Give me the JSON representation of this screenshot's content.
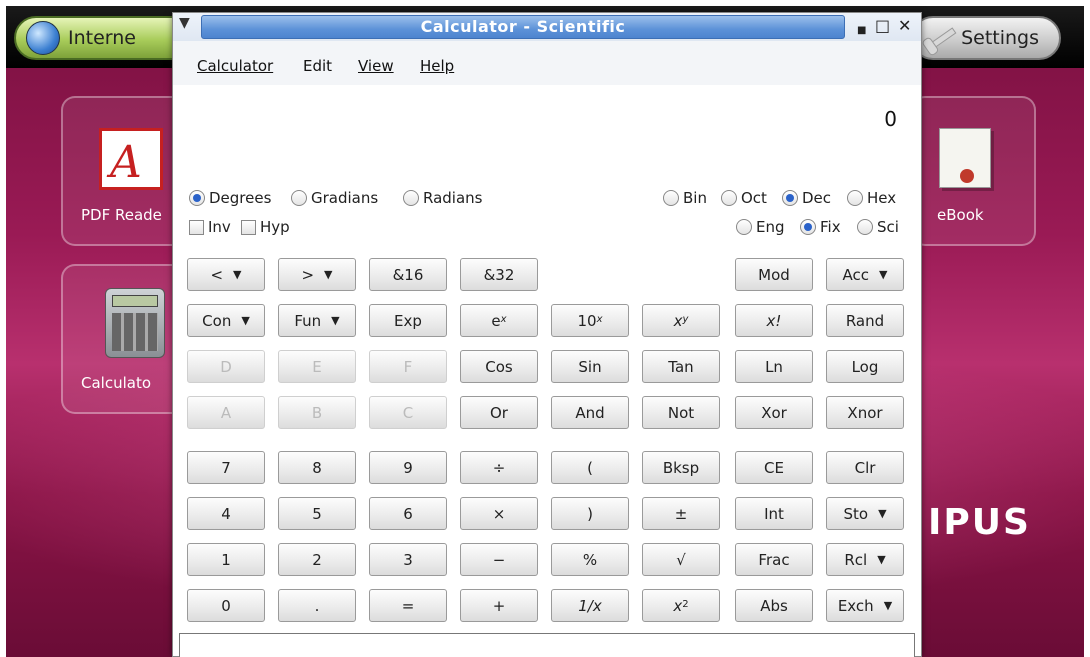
{
  "desktop": {
    "launcher_internet": "Interne",
    "launcher_settings": "Settings",
    "tiles": {
      "pdf": "PDF Reade",
      "calc": "Calculato",
      "ebook": "eBook"
    },
    "brand": "IPUS"
  },
  "window": {
    "title": "Calculator  - Scientific"
  },
  "menu": {
    "calculator": "Calculator",
    "edit": "Edit",
    "view": "View",
    "help": "Help"
  },
  "display": {
    "value": "0"
  },
  "angle": {
    "degrees": "Degrees",
    "gradians": "Gradians",
    "radians": "Radians",
    "selected": "Degrees"
  },
  "base": {
    "bin": "Bin",
    "oct": "Oct",
    "dec": "Dec",
    "hex": "Hex",
    "selected": "Dec"
  },
  "format": {
    "eng": "Eng",
    "fix": "Fix",
    "sci": "Sci",
    "selected": "Fix"
  },
  "modifiers": {
    "inv": "Inv",
    "hyp": "Hyp"
  },
  "buttons": {
    "shift_left": "<",
    "shift_right": ">",
    "and16": "&16",
    "and32": "&32",
    "mod": "Mod",
    "acc": "Acc",
    "con": "Con",
    "fun": "Fun",
    "exp": "Exp",
    "e_base": "e",
    "e_sup": "x",
    "ten_base": "10",
    "ten_sup": "x",
    "xy_base": "x",
    "xy_sup": "y",
    "fact": "x!",
    "rand": "Rand",
    "D": "D",
    "E": "E",
    "F": "F",
    "cos": "Cos",
    "sin": "Sin",
    "tan": "Tan",
    "ln": "Ln",
    "log": "Log",
    "A": "A",
    "B": "B",
    "C": "C",
    "or": "Or",
    "and": "And",
    "not": "Not",
    "xor": "Xor",
    "xnor": "Xnor",
    "n7": "7",
    "n8": "8",
    "n9": "9",
    "div": "÷",
    "lparen": "(",
    "bksp": "Bksp",
    "ce": "CE",
    "clr": "Clr",
    "n4": "4",
    "n5": "5",
    "n6": "6",
    "mul": "×",
    "rparen": ")",
    "plusminus": "±",
    "int": "Int",
    "sto": "Sto",
    "n1": "1",
    "n2": "2",
    "n3": "3",
    "minus": "−",
    "percent": "%",
    "sqrt": "√",
    "frac": "Frac",
    "rcl": "Rcl",
    "n0": "0",
    "dot": ".",
    "equals": "=",
    "plus": "+",
    "recip": "1/x",
    "sq_base": "x",
    "sq_sup": "2",
    "abs": "Abs",
    "exch": "Exch"
  }
}
